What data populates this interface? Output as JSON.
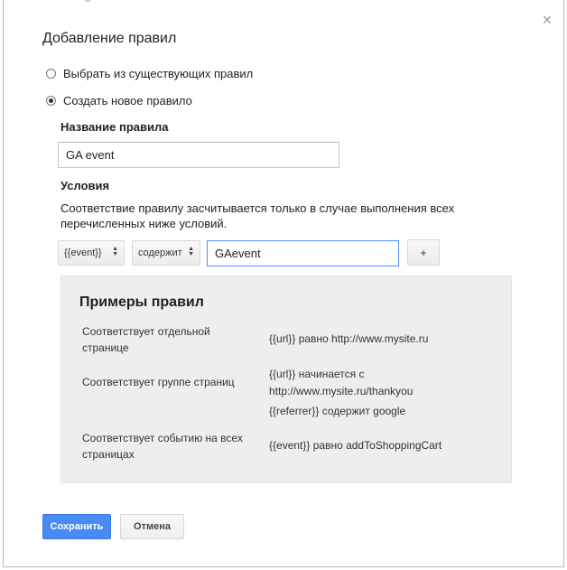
{
  "dialog": {
    "title": "Добавление правил",
    "close_icon": "×"
  },
  "options": {
    "existing_label": "Выбрать из существующих правил",
    "new_label": "Создать новое правило",
    "selected": "new"
  },
  "rule_name": {
    "label": "Название правила",
    "value": "GA event"
  },
  "conditions": {
    "label": "Условия",
    "description": "Соответствие правилу засчитывается только в случае выполнения всех перечисленных ниже условий.",
    "variable_select": "{{event}}",
    "operator_select": "содержит",
    "value_input": "GAevent",
    "add_label": "+"
  },
  "examples": {
    "title": "Примеры правил",
    "rows": [
      {
        "label": "Соответствует отдельной странице",
        "values": [
          "{{url}} равно http://www.mysite.ru"
        ]
      },
      {
        "label": "Соответствует группе страниц",
        "values": [
          "{{url}} начинается с http://www.mysite.ru/thankyou",
          "{{referrer}} содержит google"
        ]
      },
      {
        "label": "Соответствует событию на всех страницах",
        "values": [
          "{{event}} равно addToShoppingCart"
        ]
      }
    ]
  },
  "footer": {
    "save_label": "Сохранить",
    "cancel_label": "Отмена"
  },
  "colors": {
    "primary_button": "#4a8af4",
    "focus_border": "#4d90fe",
    "examples_bg": "#eeeeee"
  }
}
